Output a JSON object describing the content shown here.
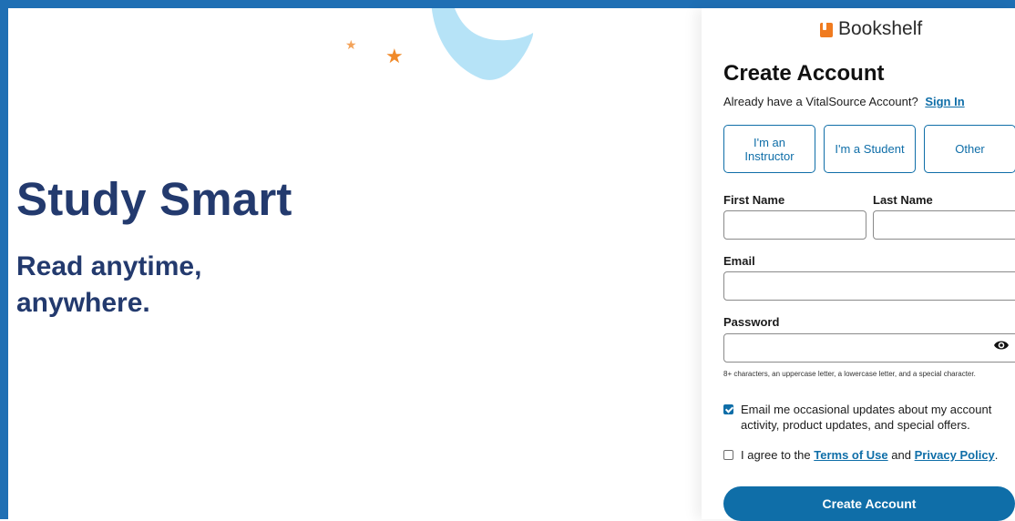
{
  "hero": {
    "title": "Study Smart",
    "subtitle": "Read anytime, anywhere."
  },
  "brand": {
    "name": "Bookshelf",
    "icon": "bookshelf-logo-icon",
    "color": "#f07b1f"
  },
  "form": {
    "title": "Create Account",
    "signin_prompt": "Already have a VitalSource Account?",
    "signin_link": "Sign In",
    "roles": [
      {
        "label": "I'm an Instructor"
      },
      {
        "label": "I'm a Student"
      },
      {
        "label": "Other"
      }
    ],
    "first_name": {
      "label": "First Name",
      "value": ""
    },
    "last_name": {
      "label": "Last Name",
      "value": ""
    },
    "email": {
      "label": "Email",
      "value": ""
    },
    "password": {
      "label": "Password",
      "value": "",
      "toggle_icon": "eye-icon",
      "hint": "8+ characters, an uppercase letter, a lowercase letter, and a special character."
    },
    "updates_checkbox": {
      "checked": true,
      "label": "Email me occasional updates about my account activity, product updates, and special offers."
    },
    "terms_checkbox": {
      "checked": false,
      "prefix": "I agree to the",
      "terms_link": "Terms of Use",
      "and": "and",
      "privacy_link": "Privacy Policy",
      "suffix": "."
    },
    "submit_label": "Create Account"
  },
  "colors": {
    "primary": "#0f6ea8",
    "hero_text": "#233a6e",
    "frame": "#1f6fb4",
    "moon": "#b6e3f7",
    "star": "#f08a2a"
  }
}
